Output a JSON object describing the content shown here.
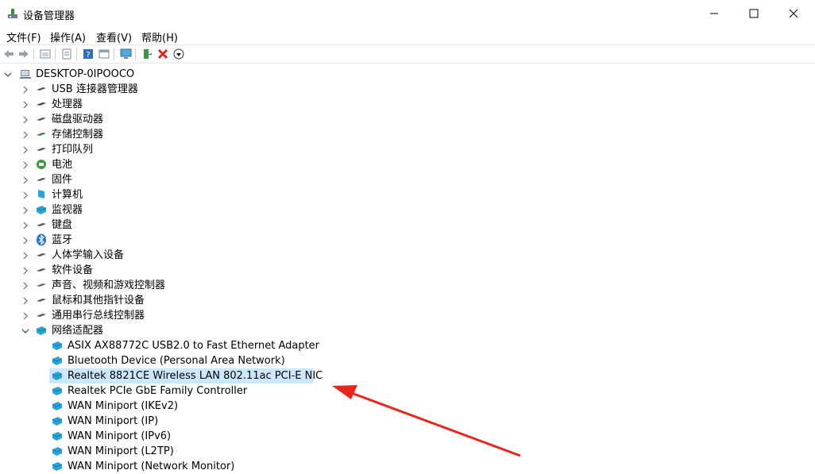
{
  "window": {
    "title": "设备管理器",
    "minimize_glyph": "─",
    "maximize_glyph": "☐",
    "close_glyph": "✕"
  },
  "menu": [
    {
      "label": "文件(F)"
    },
    {
      "label": "操作(A)"
    },
    {
      "label": "查看(V)"
    },
    {
      "label": "帮助(H)"
    }
  ],
  "toolbar": {
    "icons": [
      "back-arrow-icon",
      "forward-arrow-icon",
      "properties-icon",
      "update-driver-icon",
      "help-icon",
      "view-icon",
      "monitor-scan-icon",
      "add-driver-icon",
      "uninstall-x-icon",
      "download-icon"
    ]
  },
  "tree": {
    "root": "DESKTOP-0IPOOCO",
    "categories": [
      {
        "label": "USB 连接器管理器",
        "icon": "usb-connector-icon"
      },
      {
        "label": "处理器",
        "icon": "processor-icon"
      },
      {
        "label": "磁盘驱动器",
        "icon": "disk-drive-icon"
      },
      {
        "label": "存储控制器",
        "icon": "storage-controller-icon"
      },
      {
        "label": "打印队列",
        "icon": "print-queue-icon"
      },
      {
        "label": "电池",
        "icon": "battery-icon"
      },
      {
        "label": "固件",
        "icon": "firmware-icon"
      },
      {
        "label": "计算机",
        "icon": "computer-icon"
      },
      {
        "label": "监视器",
        "icon": "monitor-icon"
      },
      {
        "label": "键盘",
        "icon": "keyboard-icon"
      },
      {
        "label": "蓝牙",
        "icon": "bluetooth-icon"
      },
      {
        "label": "人体学输入设备",
        "icon": "hid-icon"
      },
      {
        "label": "软件设备",
        "icon": "software-device-icon"
      },
      {
        "label": "声音、视频和游戏控制器",
        "icon": "sound-icon"
      },
      {
        "label": "鼠标和其他指针设备",
        "icon": "mouse-icon"
      },
      {
        "label": "通用串行总线控制器",
        "icon": "usb-controller-icon"
      },
      {
        "label": "网络适配器",
        "icon": "network-adapter-icon",
        "expanded": true
      }
    ],
    "network_adapters": [
      "ASIX AX88772C USB2.0 to Fast Ethernet Adapter",
      "Bluetooth Device (Personal Area Network)",
      "Realtek 8821CE Wireless LAN 802.11ac PCI-E NIC",
      "Realtek PCIe GbE Family Controller",
      "WAN Miniport (IKEv2)",
      "WAN Miniport (IP)",
      "WAN Miniport (IPv6)",
      "WAN Miniport (L2TP)",
      "WAN Miniport (Network Monitor)"
    ],
    "selected_adapter": "Realtek 8821CE Wireless LAN 802.11ac PCI-E NIC"
  },
  "colors": {
    "selection": "#cce8ff",
    "arrow": "#e8261d",
    "network_icon": "#2aa3d8"
  }
}
